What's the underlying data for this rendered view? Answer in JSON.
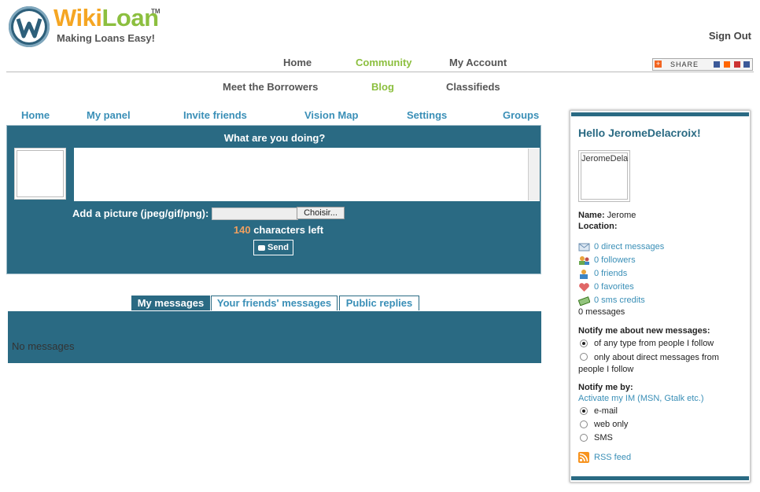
{
  "header": {
    "logo_wiki": "Wiki",
    "logo_loan": "Loan",
    "logo_tm": "TM",
    "tagline": "Making Loans Easy!",
    "sign_out": "Sign Out",
    "share_label": "SHARE"
  },
  "topnav": [
    {
      "label": "Home",
      "active": false
    },
    {
      "label": "Community",
      "active": true
    },
    {
      "label": "My Account",
      "active": false
    }
  ],
  "subnav": [
    {
      "label": "Meet the Borrowers",
      "active": false
    },
    {
      "label": "Blog",
      "active": true
    },
    {
      "label": "Classifieds",
      "active": false
    }
  ],
  "panel_menu": [
    "Home",
    "My panel",
    "Invite friends",
    "Vision Map",
    "Settings",
    "Groups"
  ],
  "status": {
    "title": "What are you doing?",
    "text_value": "",
    "picture_label": "Add a picture (jpeg/gif/png):",
    "browse_label": "Choisir...",
    "chars_count": "140",
    "chars_text": " characters left",
    "send_label": "Send"
  },
  "message_tabs": [
    {
      "label": "My messages",
      "active": true
    },
    {
      "label": "Your friends' messages",
      "active": false
    },
    {
      "label": "Public replies",
      "active": false
    }
  ],
  "messages": {
    "empty_text": "No messages"
  },
  "sidebar": {
    "hello": "Hello JeromeDelacroix!",
    "avatar_text": "JeromeDela",
    "name_label": "Name:",
    "name_value": " Jerome",
    "location_label": "Location:",
    "links": [
      {
        "label": "0 direct messages",
        "icon": "envelope-icon"
      },
      {
        "label": "0 followers",
        "icon": "followers-icon"
      },
      {
        "label": "0 friends",
        "icon": "friend-icon"
      },
      {
        "label": "0 favorites",
        "icon": "heart-icon"
      },
      {
        "label": "0 sms credits",
        "icon": "money-icon"
      }
    ],
    "messages_count": "0 messages",
    "notify_messages_title": "Notify me about new messages:",
    "notify_options": [
      {
        "label": "of any type from people I follow",
        "checked": true
      },
      {
        "label": "only about direct messages from people I follow",
        "checked": false
      }
    ],
    "notify_by_title": "Notify me by:",
    "activate_im": "Activate my IM (MSN, Gtalk etc.)",
    "notify_by_options": [
      {
        "label": "e-mail",
        "checked": true
      },
      {
        "label": "web only",
        "checked": false
      },
      {
        "label": "SMS",
        "checked": false
      }
    ],
    "rss": "RSS feed"
  },
  "colors": {
    "brand_blue": "#2a6a83",
    "link_blue": "#3a8fb7",
    "orange": "#f5a623",
    "green": "#8cbf3f"
  }
}
